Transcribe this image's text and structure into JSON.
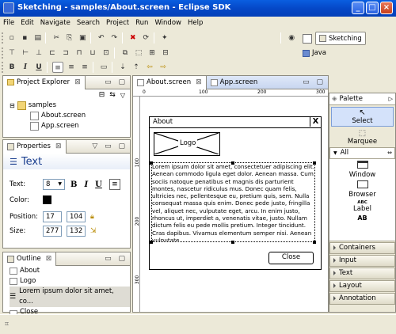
{
  "window": {
    "title": "Sketching - samples/About.screen - Eclipse SDK",
    "minimize": "_",
    "maximize": "□",
    "close": "×"
  },
  "menu": [
    "File",
    "Edit",
    "Navigate",
    "Search",
    "Project",
    "Run",
    "Window",
    "Help"
  ],
  "perspectives": {
    "active": "Sketching",
    "other": "Java"
  },
  "project_explorer": {
    "title": "Project Explorer",
    "folder": "samples",
    "files": [
      "About.screen",
      "App.screen"
    ]
  },
  "properties": {
    "title": "Properties",
    "header": "Text",
    "text_label": "Text:",
    "font_size": "8",
    "bold": "B",
    "italic": "I",
    "underline": "U",
    "color_label": "Color:",
    "color": "#000000",
    "position_label": "Position:",
    "pos_x": "17",
    "pos_y": "104",
    "size_label": "Size:",
    "width": "277",
    "height": "132"
  },
  "outline": {
    "title": "Outline",
    "items": [
      "About",
      "Logo",
      "Lorem ipsum dolor sit amet, co...",
      "Close"
    ]
  },
  "editor": {
    "tabs": [
      "About.screen",
      "App.screen"
    ],
    "ruler_h": [
      "0",
      "100",
      "200",
      "300"
    ],
    "ruler_v": [
      "100",
      "200",
      "300"
    ],
    "sketch": {
      "window_title": "About",
      "close_x": "X",
      "logo": "Logo",
      "body": "Lorem ipsum dolor sit amet, consectetuer adipiscing elit. Aenean commodo ligula eget dolor. Aenean massa. Cum sociis natoque penatibus et magnis dis parturient montes, nascetur ridiculus mus. Donec quam felis, ultricies nec, pellentesque eu, pretium quis, sem. Nulla consequat massa quis enim. Donec pede justo, fringilla vel, aliquet nec, vulputate eget, arcu. In enim justo, rhoncus ut, imperdiet a, venenatis vitae, justo. Nullam dictum felis eu pede mollis pretium. Integer tincidunt. Cras dapibus. Vivamus elementum semper nisi. Aenean vulputate",
      "button": "Close"
    }
  },
  "palette": {
    "title": "Palette",
    "select": "Select",
    "marquee": "Marquee",
    "drawer_all": "All",
    "items": [
      "Window",
      "Browser",
      "Label"
    ],
    "ab": "AB",
    "abc": "ABC",
    "drawers": [
      "Containers",
      "Input",
      "Text",
      "Layout",
      "Annotation"
    ]
  }
}
